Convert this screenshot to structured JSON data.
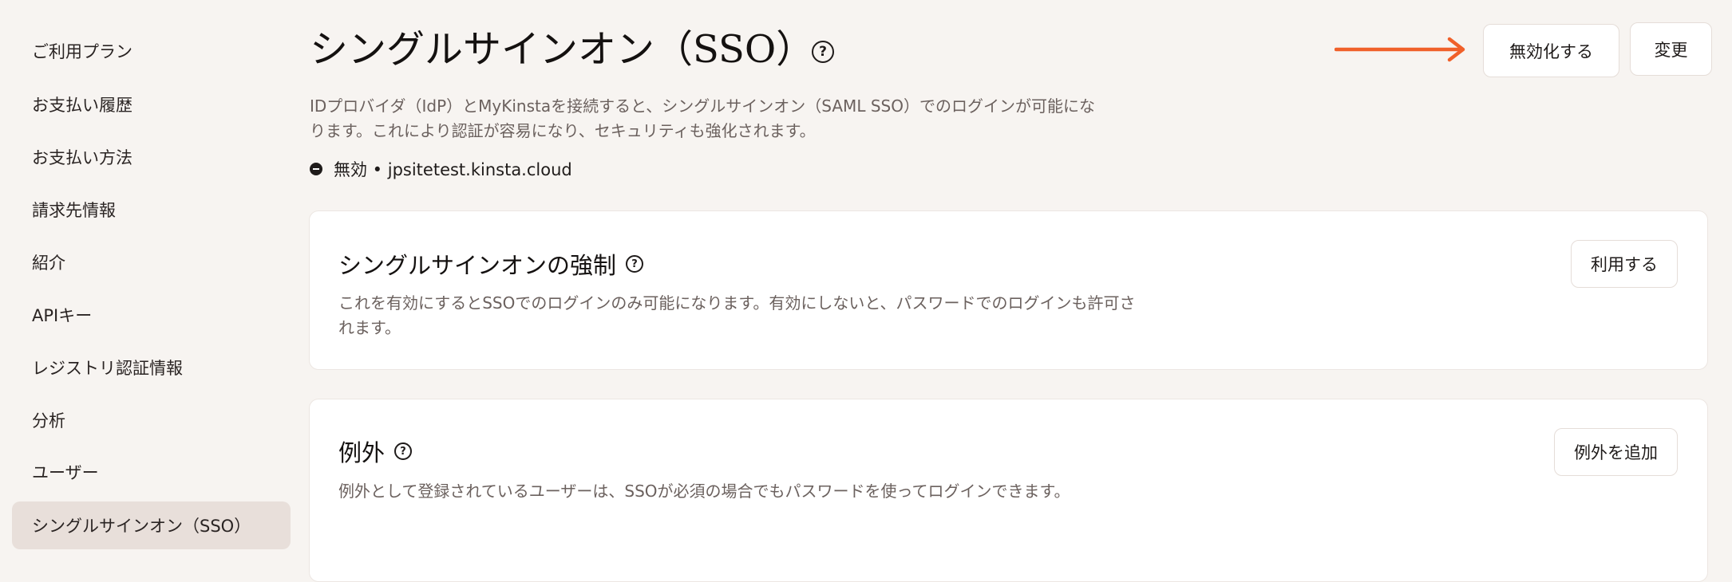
{
  "sidebar": {
    "items": [
      {
        "label": "ご利用プラン"
      },
      {
        "label": "お支払い履歴"
      },
      {
        "label": "お支払い方法"
      },
      {
        "label": "請求先情報"
      },
      {
        "label": "紹介"
      },
      {
        "label": "APIキー"
      },
      {
        "label": "レジストリ認証情報"
      },
      {
        "label": "分析"
      },
      {
        "label": "ユーザー"
      },
      {
        "label": "シングルサインオン（SSO）",
        "active": true
      }
    ]
  },
  "header": {
    "title": "シングルサインオン（SSO）",
    "help_icon": "question-circle-icon",
    "disable_label": "無効化する",
    "change_label": "変更",
    "arrow_color": "#f0602a"
  },
  "description": "IDプロバイダ（IdP）とMyKinstaを接続すると、シングルサインオン（SAML SSO）でのログインが可能になります。これにより認証が容易になり、セキュリティも強化されます。",
  "status": {
    "icon": "minus-circle-icon",
    "text": "無効 • jpsitetest.kinsta.cloud"
  },
  "enforce_card": {
    "title": "シングルサインオンの強制",
    "description": "これを有効にするとSSOでのログインのみ可能になります。有効にしないと、パスワードでのログインも許可されます。",
    "button_label": "利用する"
  },
  "exceptions_card": {
    "title": "例外",
    "description": "例外として登録されているユーザーは、SSOが必須の場合でもパスワードを使ってログインできます。",
    "button_label": "例外を追加"
  }
}
